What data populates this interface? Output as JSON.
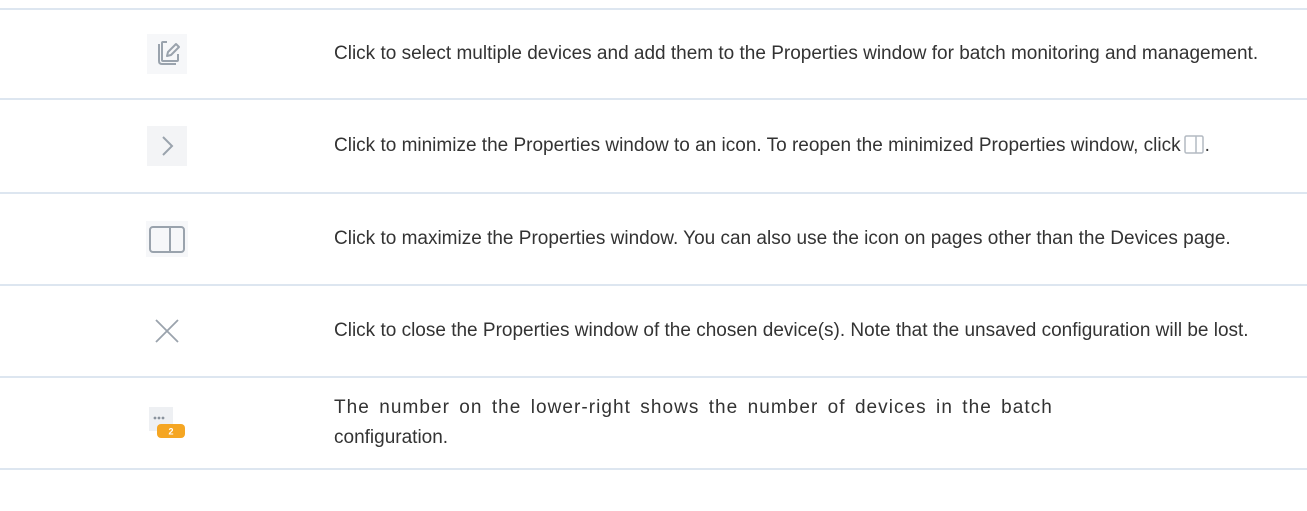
{
  "rows": [
    {
      "icon": "batch-edit-icon",
      "text": "Click to select multiple devices and add them to the Properties window for batch monitoring and management."
    },
    {
      "icon": "chevron-right-icon",
      "text_before": "Click to minimize the Properties window to an icon. To reopen the minimized Properties window, click",
      "inline_icon": "panel-icon",
      "text_after": "."
    },
    {
      "icon": "panel-icon",
      "text": "Click to maximize the Properties window. You can also use the icon on pages other than the Devices page."
    },
    {
      "icon": "close-icon",
      "text": "Click to close the Properties window of the chosen device(s). Note that the unsaved configuration will be lost."
    },
    {
      "icon": "batch-count-icon",
      "badge_count": "2",
      "text_line1": "The number on the lower-right shows the number of devices in the batch",
      "text_line2": "configuration."
    }
  ],
  "colors": {
    "text": "#333333",
    "icon_gray": "#9aa3ad",
    "icon_bg": "#f3f4f6",
    "divider": "#dde6f0",
    "badge": "#f5a623"
  }
}
